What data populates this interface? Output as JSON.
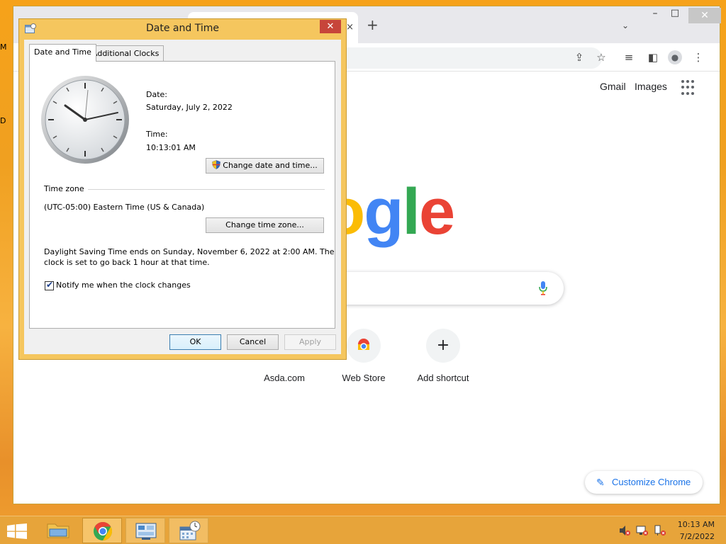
{
  "desktop": {
    "left_letters": [
      "M",
      "D"
    ]
  },
  "chrome": {
    "tab_close_glyph": "×",
    "new_tab_glyph": "+",
    "tab_search_glyph": "⌄",
    "window_controls": {
      "minimize": "–",
      "maximize": "□",
      "close": "✕"
    },
    "toolbar_icons": {
      "share": "⇪",
      "star": "☆",
      "reading_list": "≡",
      "side_panel": "◧",
      "profile": "●",
      "menu": "⋮"
    },
    "links": {
      "gmail": "Gmail",
      "images": "Images"
    },
    "logo_visible_letters": "ogle",
    "shortcuts": [
      {
        "label": "Asda.com"
      },
      {
        "label": "Web Store"
      },
      {
        "label": "Add shortcut",
        "glyph": "+"
      }
    ],
    "customize_label": "Customize Chrome",
    "customize_icon": "✎"
  },
  "dialog": {
    "title": "Date and Time",
    "close_glyph": "✕",
    "tabs": [
      "Date and Time",
      "Additional Clocks"
    ],
    "date_label": "Date:",
    "date_value": "Saturday, July 2, 2022",
    "time_label": "Time:",
    "time_value": "10:13:01 AM",
    "change_date_btn": "Change date and time...",
    "timezone_label": "Time zone",
    "timezone_value": "(UTC-05:00) Eastern Time (US & Canada)",
    "change_tz_btn": "Change time zone...",
    "dst_line1": "Daylight Saving Time ends on Sunday, November 6, 2022 at 2:00 AM. The",
    "dst_line2": "clock is set to go back 1 hour at that time.",
    "notify_label": "Notify me when the clock changes",
    "notify_checked": true,
    "ok": "OK",
    "cancel": "Cancel",
    "apply": "Apply"
  },
  "taskbar": {
    "apps": [
      "file-explorer",
      "chrome",
      "control-panel",
      "date-time"
    ],
    "time": "10:13 AM",
    "date": "7/2/2022"
  },
  "colors": {
    "dialog_frame": "#f5c65e",
    "taskbar": "#e7a43a",
    "google_blue": "#4285f4",
    "google_red": "#ea4335",
    "google_yellow": "#fbbc05",
    "google_green": "#34a853"
  }
}
